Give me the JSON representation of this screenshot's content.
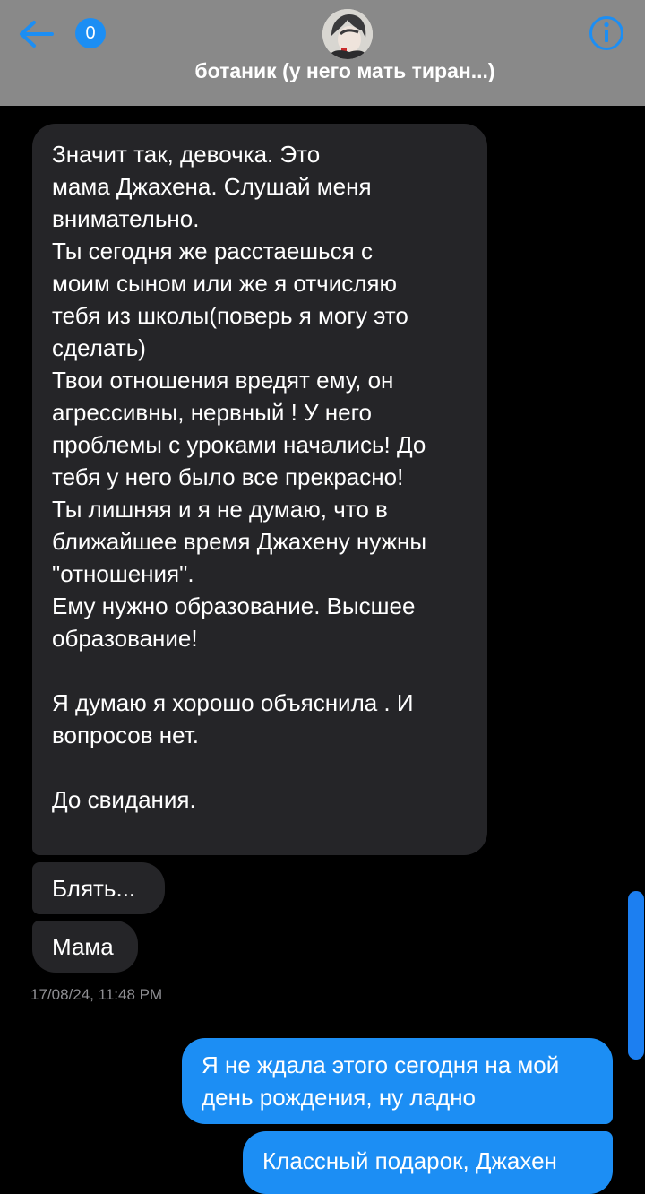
{
  "header": {
    "back_icon": "back-arrow-icon",
    "unread_count": "0",
    "avatar_icon": "contact-avatar",
    "title": "ботаник (у него мать тиран...)",
    "info_icon": "info-icon"
  },
  "messages": {
    "incoming_long": "Значит так, девочка. Это\nмама Джахена. Слушай меня\nвнимательно.\nТы сегодня же расстаешься с\nмоим сыном или же я отчисляю\nтебя из школы(поверь я могу это\nсделать)\nТвои отношения вредят ему, он\nагрессивны, нервный ! У него\nпроблемы с уроками начались! До\nтебя у него было все прекрасно!\nТы лишняя и я не думаю, что в\nближайшее время Джахену нужны\n\"отношения\".\nЕму нужно образование. Высшее\nобразование!\n\nЯ думаю я хорошо объяснила . И\nвопросов нет.\n\nДо свидания.",
    "incoming_2": "Блять...",
    "incoming_3": "Мама",
    "timestamp": "17/08/24, 11:48 PM",
    "outgoing_1": "Я не ждала этого сегодня на мой\nдень рождения, ну ладно",
    "outgoing_2": "Классный подарок, Джахен"
  },
  "colors": {
    "header_bg": "#898989",
    "accent": "#1c8ef4",
    "incoming_bubble": "#252528",
    "background": "#000000"
  }
}
